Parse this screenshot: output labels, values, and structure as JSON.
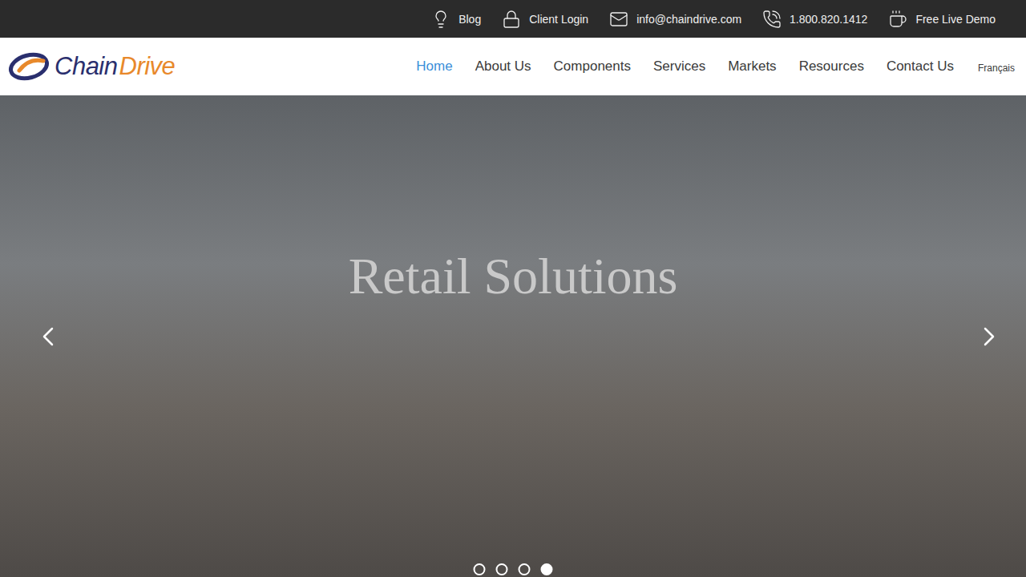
{
  "top_bar": {
    "links": [
      {
        "label": "Blog"
      },
      {
        "label": "Client Login"
      },
      {
        "label": "info@chaindrive.com"
      },
      {
        "label": "1.800.820.1412"
      },
      {
        "label": "Free Live Demo"
      }
    ]
  },
  "logo": {
    "part1": "Chain",
    "part2": "Drive"
  },
  "nav": {
    "items": [
      {
        "label": "Home",
        "selected": true
      },
      {
        "label": "About Us",
        "selected": false
      },
      {
        "label": "Components",
        "selected": false
      },
      {
        "label": "Services",
        "selected": false
      },
      {
        "label": "Markets",
        "selected": false
      },
      {
        "label": "Resources",
        "selected": false
      },
      {
        "label": "Contact Us",
        "selected": false
      }
    ],
    "language": "Français"
  },
  "hero": {
    "caption": "Retail Solutions",
    "dots": [
      {
        "selected": false
      },
      {
        "selected": false
      },
      {
        "selected": false
      },
      {
        "selected": true
      }
    ]
  }
}
